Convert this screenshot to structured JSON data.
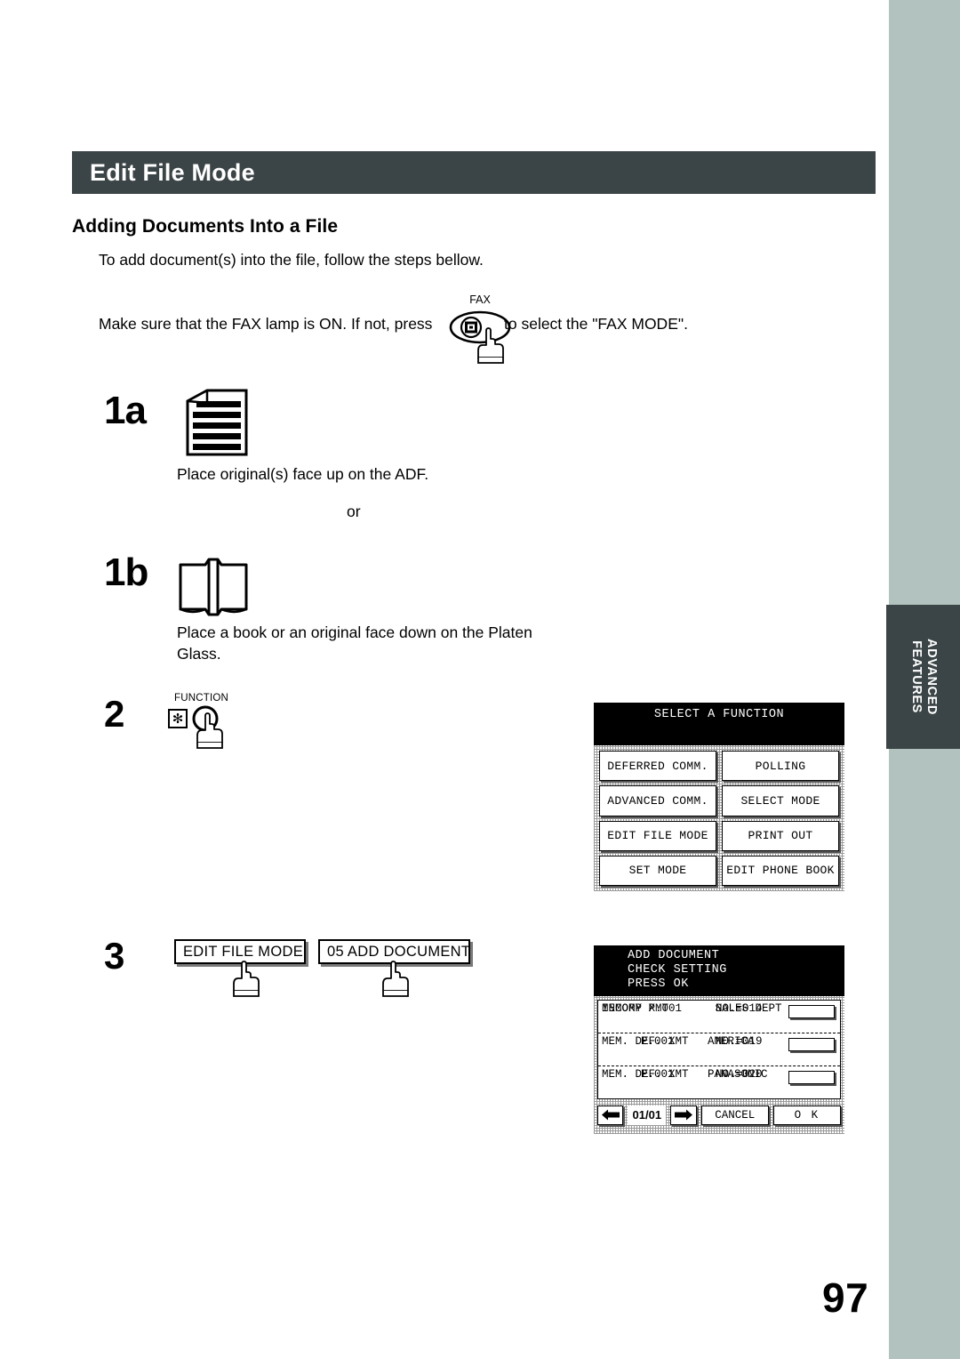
{
  "page": {
    "number": "97",
    "header_title": "Edit File Mode",
    "subheading": "Adding Documents Into a File",
    "intro_line_1": "To add document(s) into the file, follow the steps bellow.",
    "intro_line_2a": "Make sure that the FAX lamp is ON.  If not, press",
    "intro_line_2b": "to select the \"FAX MODE\".",
    "fax_key_label": "FAX"
  },
  "section_tab": {
    "line1": "ADVANCED",
    "line2": "FEATURES"
  },
  "steps": {
    "s1a": {
      "number": "1a",
      "caption": "Place original(s) face up on the ADF.",
      "icon": "document-page-icon"
    },
    "or_text": "or",
    "s1b": {
      "number": "1b",
      "caption": "Place a book or an original face down on the Platen Glass.",
      "icon": "open-book-icon"
    },
    "s2": {
      "number": "2",
      "key_label": "FUNCTION"
    },
    "s3": {
      "number": "3",
      "buttons": [
        {
          "label": "EDIT FILE MODE"
        },
        {
          "label": "05 ADD DOCUMENT"
        }
      ]
    }
  },
  "lcd_select_function": {
    "header": "SELECT A FUNCTION",
    "keys": [
      "DEFERRED COMM.",
      "POLLING",
      "ADVANCED COMM.",
      "SELECT MODE",
      "EDIT FILE MODE",
      "PRINT OUT",
      "SET MODE",
      "EDIT PHONE BOOK"
    ]
  },
  "lcd_add_document": {
    "header_line1": "ADD DOCUMENT",
    "header_line2": "CHECK SETTING",
    "header_line3": "PRESS OK",
    "jobs": [
      {
        "mode": "MEMORY XMT",
        "no": "NO.=014",
        "page": "INCOMP P.001",
        "dest": "SALES DEPT"
      },
      {
        "mode": "MEM. DEF. XMT",
        "no": "NO.=019",
        "page": "P.001",
        "dest": "AMERICA"
      },
      {
        "mode": "MEM. DEF. XMT",
        "no": "NO.=020",
        "page": "P.001",
        "dest": "PANASONIC"
      }
    ],
    "toolbar": {
      "prev_icon": "left-arrow-icon",
      "page_indicator": "01/01",
      "next_icon": "right-arrow-icon",
      "cancel_label": "CANCEL",
      "ok_label": "O K"
    }
  },
  "colors": {
    "header_band": "#3b4446",
    "edge_strip": "#b2c2bf",
    "tab": "#3b4446"
  }
}
